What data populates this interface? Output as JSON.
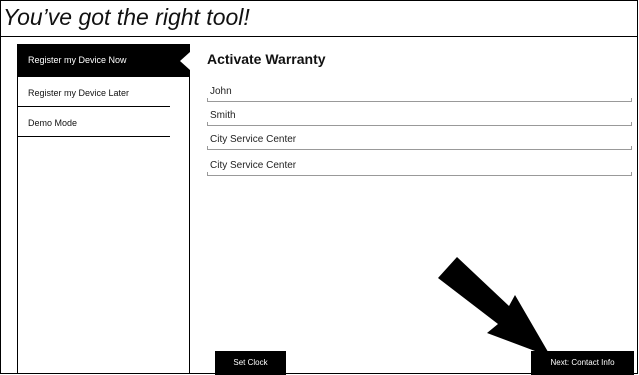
{
  "banner": {
    "title": "You’ve got the right tool!"
  },
  "sidebar": {
    "items": [
      {
        "label": "Register my Device Now",
        "active": true
      },
      {
        "label": "Register my Device Later",
        "active": false
      },
      {
        "label": "Demo Mode",
        "active": false
      }
    ]
  },
  "main": {
    "title": "Activate Warranty",
    "fields": [
      {
        "value": "John"
      },
      {
        "value": "Smith"
      },
      {
        "value": "City Service Center"
      },
      {
        "value": "City Service Center"
      }
    ]
  },
  "buttons": {
    "set_clock": "Set Clock",
    "next": "Next: Contact Info"
  },
  "colors": {
    "accent": "#000000",
    "background": "#ffffff",
    "field_line": "#999999"
  },
  "icons": {
    "pointer": "arrow-pointer-icon"
  }
}
